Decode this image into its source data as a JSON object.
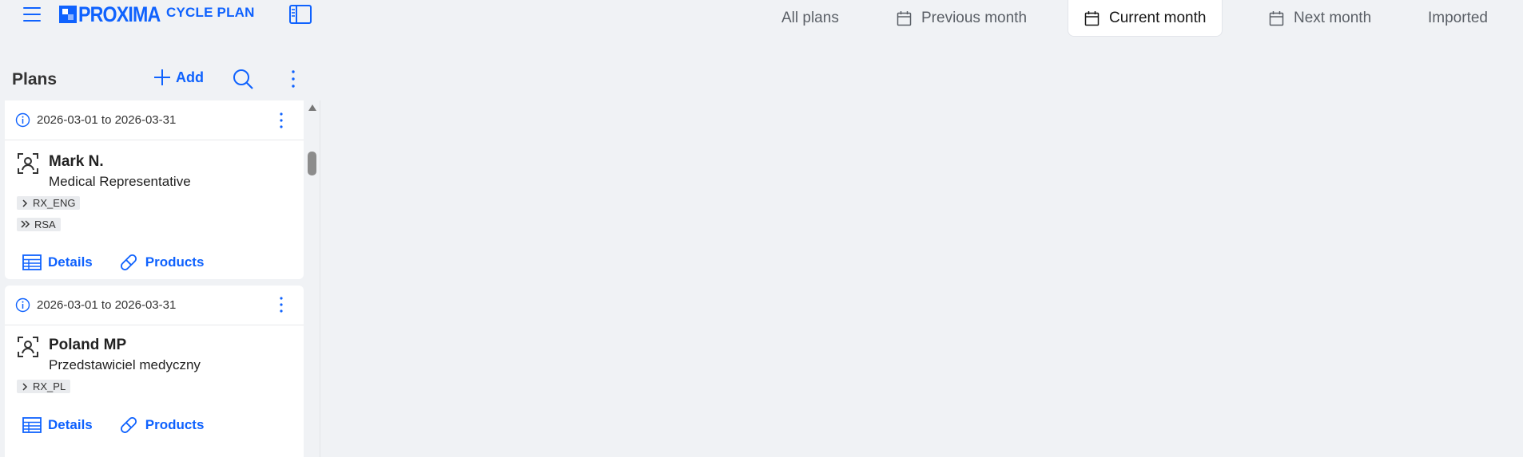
{
  "header": {
    "logo_text": "PROXIMA",
    "app_name": "CYCLE PLAN",
    "icons": {
      "menu": "hamburger-icon",
      "panel_toggle": "sidebar-panel-icon"
    },
    "tabs": [
      {
        "label": "All plans",
        "icon": null,
        "active": false
      },
      {
        "label": "Previous month",
        "icon": "calendar-icon",
        "active": false
      },
      {
        "label": "Current month",
        "icon": "calendar-icon",
        "active": true
      },
      {
        "label": "Next month",
        "icon": "calendar-icon",
        "active": false
      },
      {
        "label": "Imported",
        "icon": null,
        "active": false
      }
    ]
  },
  "plans": {
    "title": "Plans",
    "add_label": "Add",
    "items": [
      {
        "period": "2026-03-01 to 2026-03-31",
        "name": "Mark N.",
        "role": "Medical Representative",
        "tags": [
          {
            "label": "RX_ENG",
            "icon": "chevron-right-icon"
          },
          {
            "label": "RSA",
            "icon": "double-chevron-right-icon"
          }
        ],
        "actions": {
          "details": "Details",
          "products": "Products"
        }
      },
      {
        "period": "2026-03-01 to 2026-03-31",
        "name": "Poland MP",
        "role": "Przedstawiciel medyczny",
        "tags": [
          {
            "label": "RX_PL",
            "icon": "chevron-right-icon"
          }
        ],
        "actions": {
          "details": "Details",
          "products": "Products"
        }
      }
    ]
  },
  "colors": {
    "accent": "#0f62fe",
    "background": "#f0f2f5",
    "card": "#ffffff",
    "tag_bg": "#e9ebee"
  }
}
